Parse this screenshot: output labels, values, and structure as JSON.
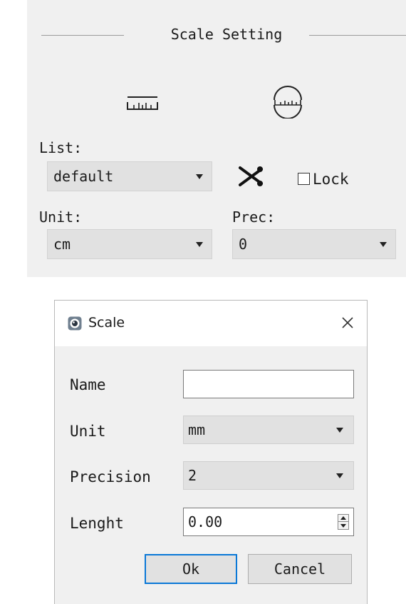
{
  "scale_setting": {
    "group_title": "Scale Setting",
    "tools": [
      {
        "icon": "linear-ruler-icon"
      },
      {
        "icon": "arc-ruler-icon"
      }
    ],
    "list": {
      "label": "List:",
      "value": "default"
    },
    "delete_icon": "scissors-icon",
    "lock": {
      "label": "Lock",
      "checked": false
    },
    "unit": {
      "label": "Unit:",
      "value": "cm"
    },
    "precision": {
      "label": "Prec:",
      "value": "0"
    }
  },
  "dialog": {
    "title": "Scale",
    "close_label": "×",
    "name": {
      "label": "Name",
      "value": ""
    },
    "unit": {
      "label": "Unit",
      "value": "mm"
    },
    "precision": {
      "label": "Precision",
      "value": "2"
    },
    "length": {
      "label": "Lenght",
      "value": "0.00"
    },
    "ok_label": "Ok",
    "cancel_label": "Cancel"
  }
}
